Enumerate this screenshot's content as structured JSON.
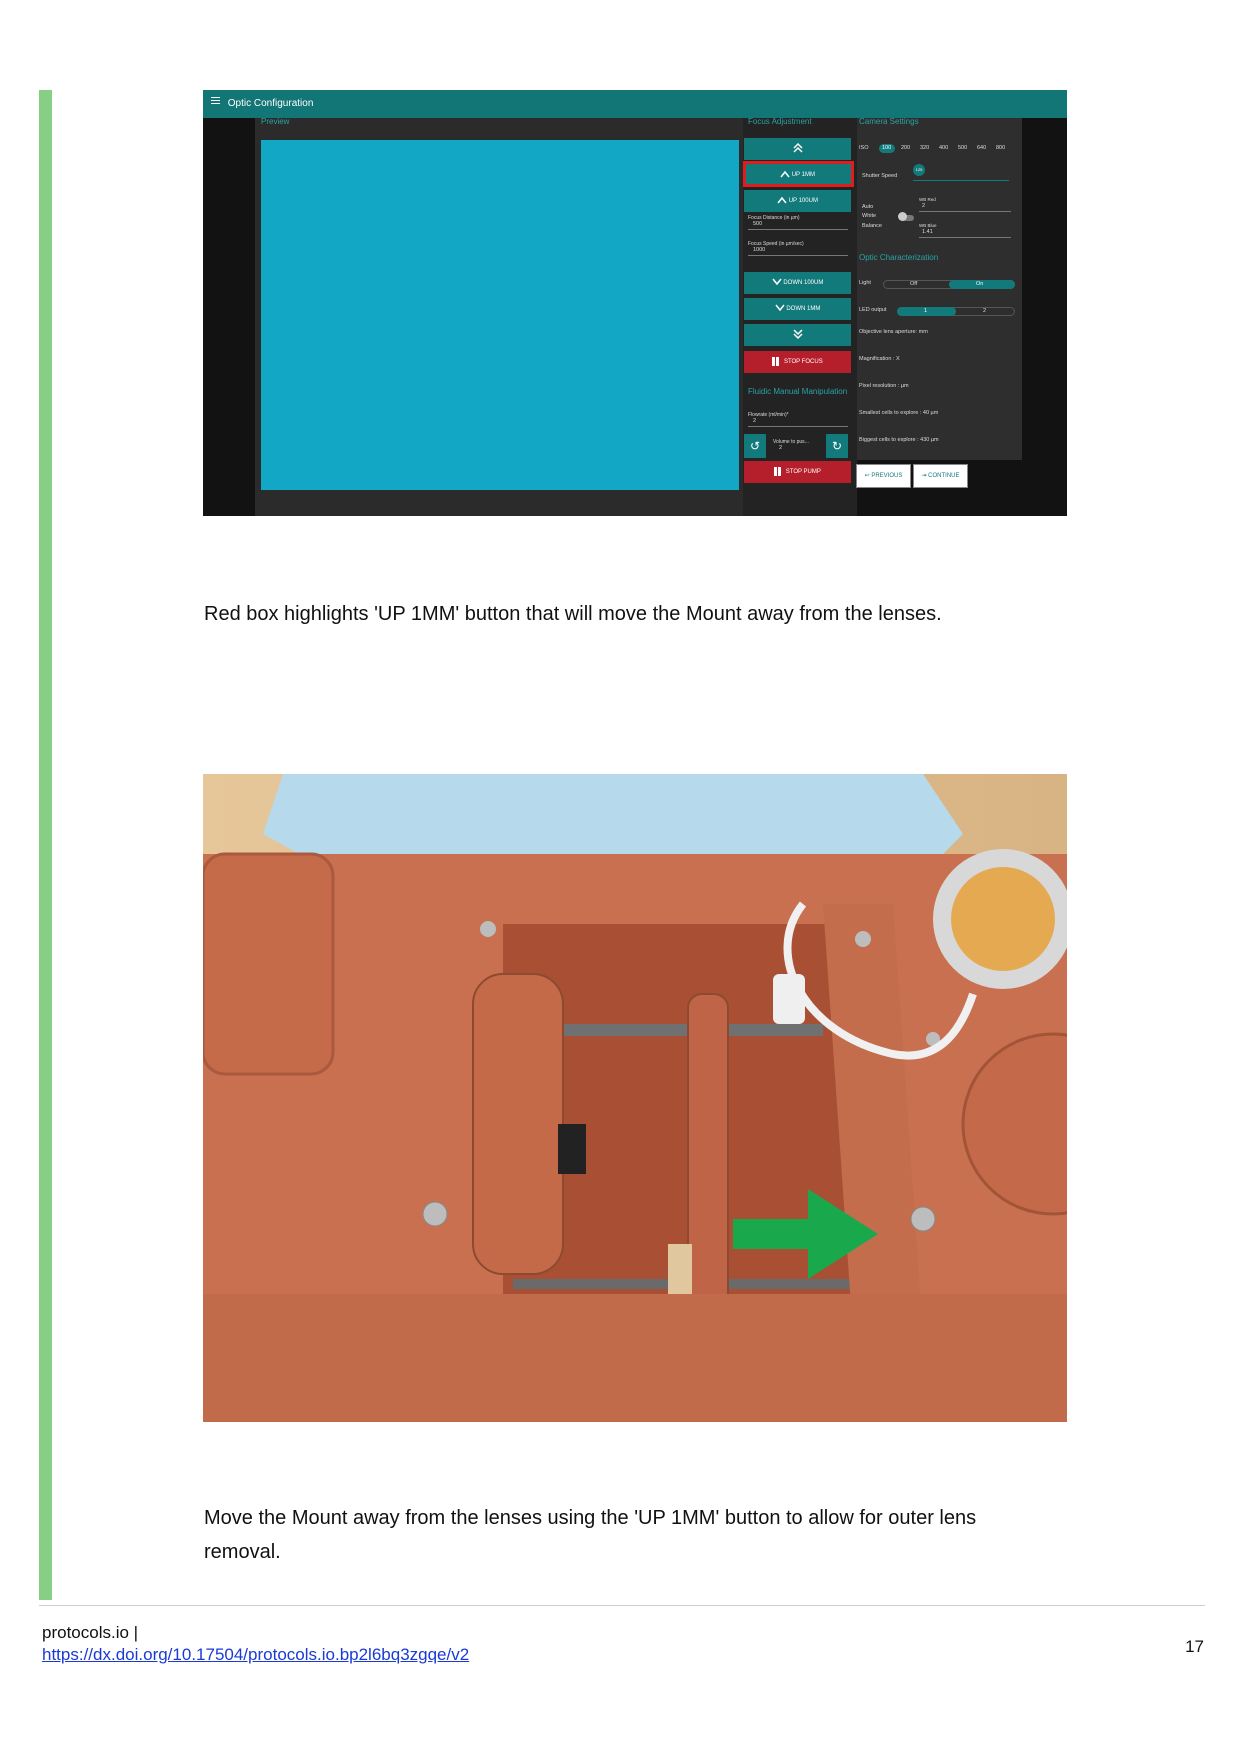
{
  "screenshot": {
    "app_title": "Optic Configuration",
    "preview_label": "Preview",
    "focus_title": "Focus Adjustment",
    "camera_title": "Camera Settings",
    "buttons": {
      "up_1mm": "UP 1MM",
      "up_100um": "UP 100UM",
      "down_100um": "DOWN 100UM",
      "down_1mm": "DOWN 1MM",
      "stop_focus": "STOP FOCUS",
      "stop_pump": "STOP PUMP",
      "previous": "PREVIOUS",
      "continue": "CONTINUE"
    },
    "focus_distance_label": "Focus Distance (in µm)",
    "focus_distance_value": "500",
    "focus_speed_label": "Focus Speed (in µm/sec)",
    "focus_speed_value": "1000",
    "fluidic_title": "Fluidic Manual Manipulation",
    "flowrate_label": "Flowrate (ml/min)*",
    "flowrate_value": "2",
    "volume_label": "Volume to pus...",
    "volume_value": "2",
    "iso_label": "ISO",
    "iso_values": [
      "100",
      "200",
      "320",
      "400",
      "500",
      "640",
      "800"
    ],
    "shutter_label": "Shutter Speed",
    "shutter_value": "125",
    "awb_label_1": "Auto",
    "awb_label_2": "White",
    "awb_label_3": "Balance",
    "wb_red_label": "WB Red",
    "wb_red_value": "2",
    "wb_blue_label": "WB Blue",
    "wb_blue_value": "1.41",
    "optic_title": "Optic Characterization",
    "light_label": "Light",
    "light_off": "Off",
    "light_on": "On",
    "led_label": "LED output",
    "led_1": "1",
    "led_2": "2",
    "aperture": "Objective lens aperture: mm",
    "magnification": "Magnification : X",
    "pixel_res": "Pixel resolution : µm",
    "smallest": "Smallest cells to explore : 40 µm",
    "biggest": "Biggest cells to explore : 430 µm",
    "highlight_color": "#e01d1d",
    "accent_color": "#137a7b"
  },
  "caption_1": "Red box highlights 'UP 1MM' button that will move the Mount away from the lenses.",
  "photo": {
    "arrow_color": "#1aa84c"
  },
  "caption_2_line1": "Move the Mount away from the lenses using the 'UP 1MM' button to allow for outer lens",
  "caption_2_line2": "removal.",
  "footer": {
    "site": "protocols.io |",
    "link": "https://dx.doi.org/10.17504/protocols.io.bp2l6bq3zgqe/v2",
    "page_number": "17"
  }
}
